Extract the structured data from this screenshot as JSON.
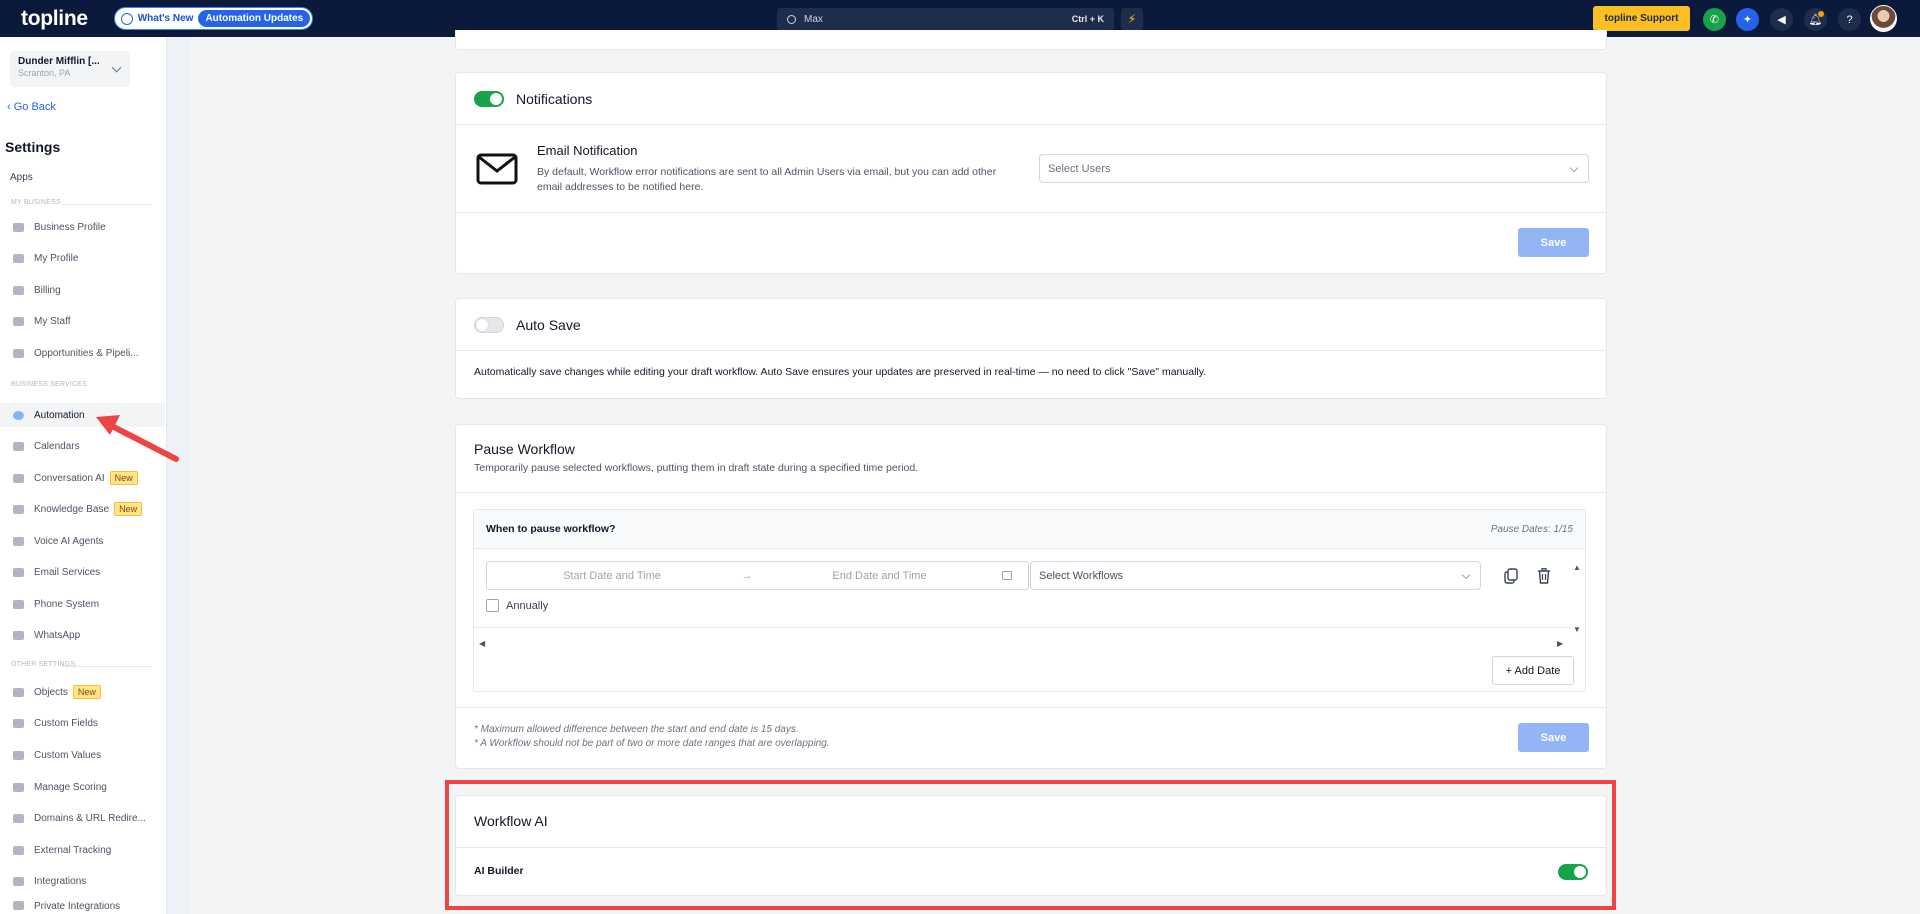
{
  "topbar": {
    "logo": "topline",
    "whats_new": "What's New",
    "automation_updates": "Automation Updates",
    "search_value": "Max",
    "search_shortcut": "Ctrl + K",
    "support_label": "topline Support"
  },
  "sidebar": {
    "account_name": "Dunder Mifflin [...",
    "account_location": "Scranton, PA",
    "go_back": "Go Back",
    "title": "Settings",
    "apps": "Apps",
    "sections": {
      "my_business": "MY BUSINESS",
      "business_services": "BUSINESS SERVICES",
      "other_settings": "OTHER SETTINGS"
    },
    "items": {
      "business_profile": "Business Profile",
      "my_profile": "My Profile",
      "billing": "Billing",
      "my_staff": "My Staff",
      "opportunities": "Opportunities & Pipeli...",
      "automation": "Automation",
      "calendars": "Calendars",
      "conversation_ai": "Conversation AI",
      "knowledge_base": "Knowledge Base",
      "voice_ai_agents": "Voice AI Agents",
      "email_services": "Email Services",
      "phone_system": "Phone System",
      "whatsapp": "WhatsApp",
      "objects": "Objects",
      "custom_fields": "Custom Fields",
      "custom_values": "Custom Values",
      "manage_scoring": "Manage Scoring",
      "domains": "Domains & URL Redire...",
      "external_tracking": "External Tracking",
      "integrations": "Integrations",
      "private_integrations": "Private Integrations"
    },
    "badge_new": "New"
  },
  "notifications": {
    "title": "Notifications",
    "email_title": "Email Notification",
    "email_desc_1": "By default, Workflow error notifications are sent to all Admin Users via email, but you can add other",
    "email_desc_2": "email addresses to be notified here.",
    "select_users": "Select Users",
    "save": "Save"
  },
  "auto_save": {
    "title": "Auto Save",
    "desc": "Automatically save changes while editing your draft workflow. Auto Save ensures your updates are preserved in real-time — no need to click \"Save\" manually."
  },
  "pause_workflow": {
    "title": "Pause Workflow",
    "desc": "Temporarily pause selected workflows, putting them in draft state during a specified time period.",
    "when_label": "When to pause workflow?",
    "pause_dates": "Pause Dates: 1/15",
    "start_placeholder": "Start Date and Time",
    "end_placeholder": "End Date and Time",
    "select_workflows": "Select Workflows",
    "annually": "Annually",
    "add_date": "+ Add Date",
    "note_1": "* Maximum allowed difference between the start and end date is 15 days.",
    "note_2": "* A Workflow should not be part of two or more date ranges that are overlapping.",
    "save": "Save"
  },
  "workflow_ai": {
    "title": "Workflow AI",
    "ai_builder": "AI Builder"
  },
  "colors": {
    "topbar": "#0b1a3a",
    "accent": "#2563eb",
    "toggle_on": "#16a34a",
    "save_disabled": "#93b4f5",
    "highlight": "#ef4444"
  }
}
